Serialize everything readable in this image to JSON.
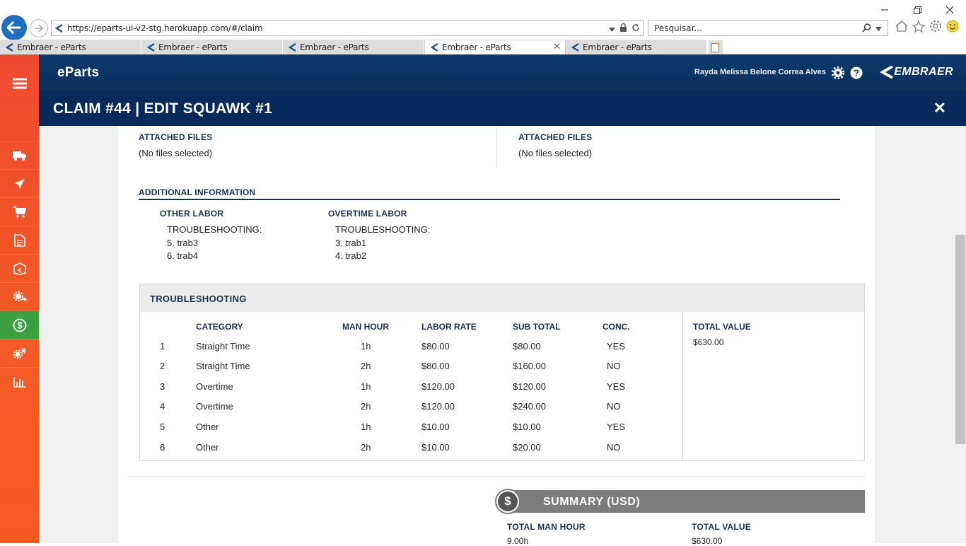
{
  "browser": {
    "url": "https://eparts-ui-v2-stg.herokuapp.com/#/claim",
    "search_placeholder": "Pesquisar...",
    "tabs": [
      {
        "label": "Embraer - eParts"
      },
      {
        "label": "Embraer - eParts"
      },
      {
        "label": "Embraer - eParts"
      },
      {
        "label": "Embraer - eParts"
      },
      {
        "label": "Embraer - eParts"
      }
    ],
    "active_tab": 3
  },
  "header": {
    "brand": "eParts",
    "user_name": "Rayda Melissa Belone Correa Alves",
    "logo_text": "EMBRAER"
  },
  "modal": {
    "title": "CLAIM #44 | EDIT SQUAWK #1",
    "close": "✕"
  },
  "attached_left": {
    "label": "ATTACHED FILES",
    "value": "(No files selected)"
  },
  "attached_right": {
    "label": "ATTACHED FILES",
    "value": "(No files selected)"
  },
  "additional": {
    "title": "ADDITIONAL INFORMATION",
    "other_labor": {
      "label": "OTHER LABOR",
      "group": "TROUBLESHOOTING:",
      "items": [
        "5. trab3",
        "6. trab4"
      ]
    },
    "overtime_labor": {
      "label": "OVERTIME LABOR",
      "group": "TROUBLESHOOTING:",
      "items": [
        "3. trab1",
        "4. trab2"
      ]
    }
  },
  "troubleshooting": {
    "title": "TROUBLESHOOTING",
    "columns": {
      "category": "CATEGORY",
      "man_hour": "MAN HOUR",
      "labor_rate": "LABOR RATE",
      "sub_total": "SUB TOTAL",
      "conc": "CONC."
    },
    "rows": [
      {
        "n": "1",
        "category": "Straight Time",
        "man_hour": "1h",
        "labor_rate": "$80.00",
        "sub_total": "$80.00",
        "conc": "YES"
      },
      {
        "n": "2",
        "category": "Straight Time",
        "man_hour": "2h",
        "labor_rate": "$80.00",
        "sub_total": "$160.00",
        "conc": "NO"
      },
      {
        "n": "3",
        "category": "Overtime",
        "man_hour": "1h",
        "labor_rate": "$120.00",
        "sub_total": "$120.00",
        "conc": "YES"
      },
      {
        "n": "4",
        "category": "Overtime",
        "man_hour": "2h",
        "labor_rate": "$120.00",
        "sub_total": "$240.00",
        "conc": "NO"
      },
      {
        "n": "5",
        "category": "Other",
        "man_hour": "1h",
        "labor_rate": "$10.00",
        "sub_total": "$10.00",
        "conc": "YES"
      },
      {
        "n": "6",
        "category": "Other",
        "man_hour": "2h",
        "labor_rate": "$10.00",
        "sub_total": "$20.00",
        "conc": "NO"
      }
    ],
    "total_label": "TOTAL VALUE",
    "total_value": "$630.00"
  },
  "summary": {
    "title": "SUMMARY (USD)",
    "total_man_hour_label": "TOTAL MAN HOUR",
    "total_man_hour": "9.00h",
    "total_value_label": "TOTAL VALUE",
    "total_value": "$630.00"
  },
  "colors": {
    "header_blue": "#0a2f5c",
    "modal_blue": "#062a5b",
    "sidebar_orange": "#f35a25",
    "active_green": "#3aa040",
    "summary_gray": "#7c7c7c"
  }
}
